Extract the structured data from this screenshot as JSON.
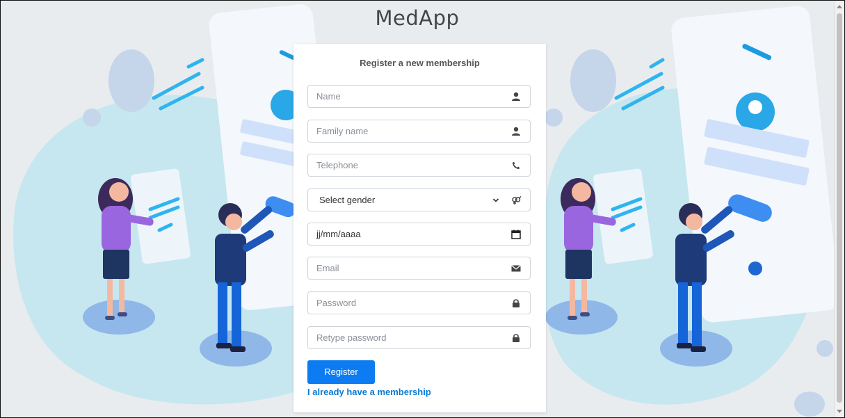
{
  "app": {
    "title": "MedApp"
  },
  "form": {
    "heading": "Register a new membership",
    "fields": {
      "name": {
        "placeholder": "Name",
        "icon": "user-icon"
      },
      "family_name": {
        "placeholder": "Family name",
        "icon": "user-icon"
      },
      "telephone": {
        "placeholder": "Telephone",
        "icon": "phone-icon"
      },
      "gender": {
        "selected": "Select gender",
        "icon": "gender-icon"
      },
      "birthdate": {
        "value": "jj/mm/aaaa",
        "icon": "calendar-icon"
      },
      "email": {
        "placeholder": "Email",
        "icon": "envelope-icon"
      },
      "password": {
        "placeholder": "Password",
        "icon": "lock-icon"
      },
      "retype_password": {
        "placeholder": "Retype password",
        "icon": "lock-icon"
      }
    },
    "register_label": "Register",
    "login_link": "I already have a membership"
  },
  "colors": {
    "primary": "#0d7cf2",
    "link": "#0b7ad1",
    "background": "#e9ecef"
  }
}
